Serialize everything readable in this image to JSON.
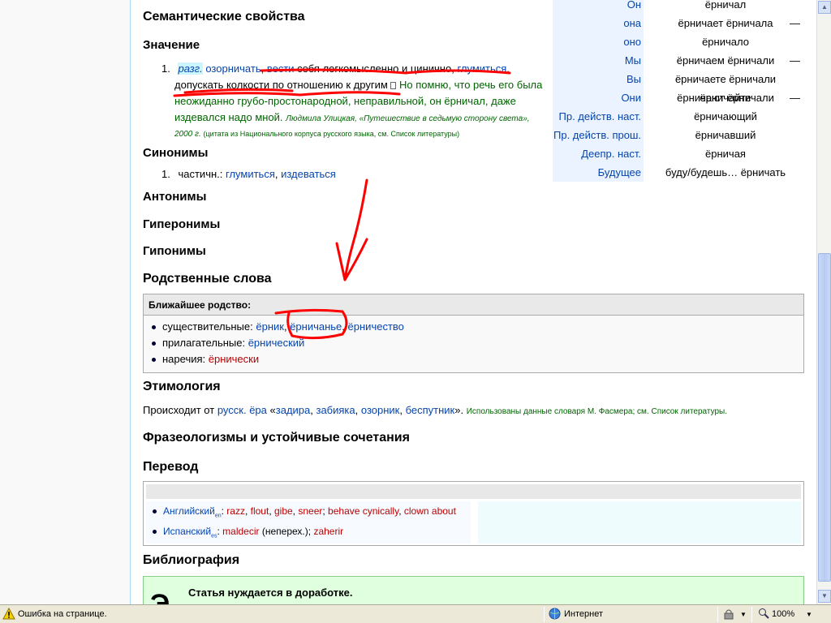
{
  "sections": {
    "semantic": "Семантические свойства",
    "meaning": "Значение",
    "synonyms": "Синонимы",
    "antonyms": "Антонимы",
    "hypernyms": "Гиперонимы",
    "hyponyms": "Гипонимы",
    "related": "Родственные слова",
    "etymology": "Этимология",
    "phraseology": "Фразеологизмы и устойчивые сочетания",
    "translation": "Перевод",
    "bibliography": "Библиография"
  },
  "meaning": {
    "num": "1.",
    "tag": "разг.",
    "links": [
      "озорничать",
      "вести"
    ],
    "text1": "себя легкомысленно и цинично,",
    "link3": "глумиться",
    "text2": "допускать колкости по отношению к другим",
    "ex1": "Но помню, что речь его была",
    "ex2": "неожиданно грубо-простонародной, неправильной, он ёрничал, даже",
    "ex3": "издевался надо мной.",
    "author": "Людмила Улицкая, «Путешествие в седьмую сторону света»,",
    "year": "2000 г.",
    "source": "(цитата из Национального корпуса русского языка, см. Список литературы)"
  },
  "synonyms": {
    "num": "1.",
    "prefix": "частичн.:",
    "links": [
      "глумиться",
      "издеваться"
    ]
  },
  "conjugation": [
    {
      "label": "Он",
      "v1": "ёрничал",
      "dash": ""
    },
    {
      "label": "она",
      "v1": "ёрничает ёрничала",
      "dash": "—"
    },
    {
      "label": "оно",
      "v1": "ёрничало",
      "dash": ""
    },
    {
      "label": "Мы",
      "v1": "ёрничаем ёрничали",
      "dash": "—"
    },
    {
      "label": "Вы",
      "v1": "ёрничаете ёрничали ёрничайте",
      "dash": ""
    },
    {
      "label": "Они",
      "v1": "ёрничают ёрничали",
      "dash": "—"
    },
    {
      "label": "Пр. действ. наст.",
      "v1": "ёрничающий",
      "dash": ""
    },
    {
      "label": "Пр. действ. прош.",
      "v1": "ёрничавший",
      "dash": ""
    },
    {
      "label": "Деепр. наст.",
      "v1": "ёрничая",
      "dash": ""
    },
    {
      "label": "Будущее",
      "v1": "буду/будешь… ёрничать",
      "dash": ""
    }
  ],
  "related": {
    "header": "Ближайшее родство:",
    "nouns_label": "существительные:",
    "nouns": [
      "ёрник",
      "ёрничанье",
      "ёрничество"
    ],
    "adj_label": "прилагательные:",
    "adj": "ёрнический",
    "adv_label": "наречия:",
    "adv": "ёрнически"
  },
  "etymology": {
    "prefix": "Происходит от",
    "lang": "русск.",
    "word": "ёра",
    "open": "«",
    "links": [
      "задира",
      "забияка",
      "озорник",
      "беспутник"
    ],
    "close": "».",
    "note": "Использованы данные словаря М. Фасмера; см. Список литературы."
  },
  "translation": {
    "en_lang": "Английский",
    "en_sub": "en",
    "en_words": [
      "razz",
      "flout",
      "gibe",
      "sneer",
      "behave cynically",
      "clown about"
    ],
    "es_lang": "Испанский",
    "es_sub": "es",
    "es_w1": "maldecir",
    "es_mid": "(неперех.);",
    "es_w2": "zaherir"
  },
  "notice": {
    "title": "Статья нуждается в доработке."
  },
  "statusbar": {
    "error": "Ошибка на странице.",
    "zone": "Интернет",
    "zoom": "100%"
  },
  "colors": {
    "link": "#0645ad",
    "redlink": "#ba0000",
    "annotation": "#ff0000"
  }
}
